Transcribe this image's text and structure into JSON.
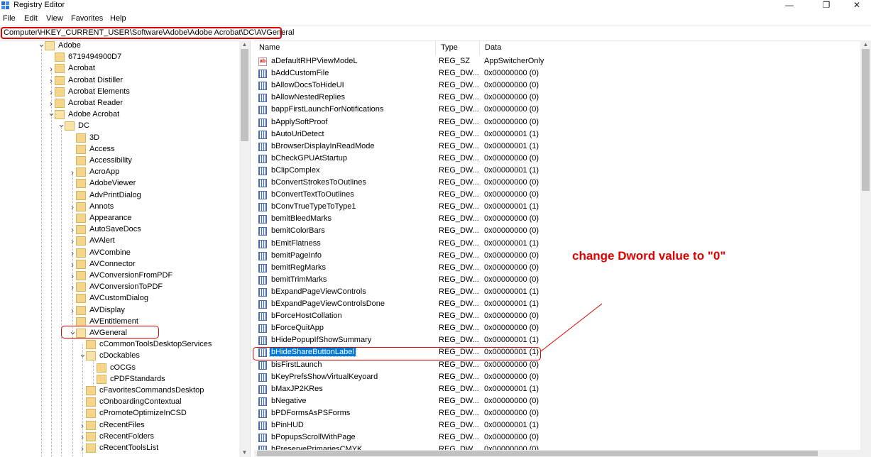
{
  "window": {
    "title": "Registry Editor",
    "minimize_glyph": "—",
    "maximize_glyph": "❐",
    "close_glyph": "✕"
  },
  "menu": [
    "File",
    "Edit",
    "View",
    "Favorites",
    "Help"
  ],
  "address": "Computer\\HKEY_CURRENT_USER\\Software\\Adobe\\Adobe Acrobat\\DC\\AVGeneral",
  "tree": [
    {
      "label": "Adobe",
      "level": 0,
      "state": "expanded"
    },
    {
      "label": "6719494900D7",
      "level": 1,
      "state": "leaf"
    },
    {
      "label": "Acrobat",
      "level": 1,
      "state": "collapsed"
    },
    {
      "label": "Acrobat Distiller",
      "level": 1,
      "state": "collapsed"
    },
    {
      "label": "Acrobat Elements",
      "level": 1,
      "state": "collapsed"
    },
    {
      "label": "Acrobat Reader",
      "level": 1,
      "state": "collapsed"
    },
    {
      "label": "Adobe Acrobat",
      "level": 1,
      "state": "expanded"
    },
    {
      "label": "DC",
      "level": 2,
      "state": "expanded"
    },
    {
      "label": "3D",
      "level": 3,
      "state": "leaf"
    },
    {
      "label": "Access",
      "level": 3,
      "state": "leaf"
    },
    {
      "label": "Accessibility",
      "level": 3,
      "state": "leaf"
    },
    {
      "label": "AcroApp",
      "level": 3,
      "state": "collapsed"
    },
    {
      "label": "AdobeViewer",
      "level": 3,
      "state": "leaf"
    },
    {
      "label": "AdvPrintDialog",
      "level": 3,
      "state": "leaf"
    },
    {
      "label": "Annots",
      "level": 3,
      "state": "collapsed"
    },
    {
      "label": "Appearance",
      "level": 3,
      "state": "leaf"
    },
    {
      "label": "AutoSaveDocs",
      "level": 3,
      "state": "collapsed"
    },
    {
      "label": "AVAlert",
      "level": 3,
      "state": "collapsed"
    },
    {
      "label": "AVCombine",
      "level": 3,
      "state": "collapsed"
    },
    {
      "label": "AVConnector",
      "level": 3,
      "state": "collapsed"
    },
    {
      "label": "AVConversionFromPDF",
      "level": 3,
      "state": "collapsed"
    },
    {
      "label": "AVConversionToPDF",
      "level": 3,
      "state": "collapsed"
    },
    {
      "label": "AVCustomDialog",
      "level": 3,
      "state": "leaf"
    },
    {
      "label": "AVDisplay",
      "level": 3,
      "state": "collapsed"
    },
    {
      "label": "AVEntitlement",
      "level": 3,
      "state": "leaf"
    },
    {
      "label": "AVGeneral",
      "level": 3,
      "state": "expanded",
      "selected": true
    },
    {
      "label": "cCommonToolsDesktopServices",
      "level": 4,
      "state": "leaf"
    },
    {
      "label": "cDockables",
      "level": 4,
      "state": "expanded"
    },
    {
      "label": "cOCGs",
      "level": 5,
      "state": "leaf"
    },
    {
      "label": "cPDFStandards",
      "level": 5,
      "state": "leaf"
    },
    {
      "label": "cFavoritesCommandsDesktop",
      "level": 4,
      "state": "leaf"
    },
    {
      "label": "cOnboardingContextual",
      "level": 4,
      "state": "leaf"
    },
    {
      "label": "cPromoteOptimizeInCSD",
      "level": 4,
      "state": "leaf"
    },
    {
      "label": "cRecentFiles",
      "level": 4,
      "state": "collapsed"
    },
    {
      "label": "cRecentFolders",
      "level": 4,
      "state": "collapsed"
    },
    {
      "label": "cRecentToolsList",
      "level": 4,
      "state": "collapsed"
    }
  ],
  "columns": {
    "name": "Name",
    "type": "Type",
    "data": "Data"
  },
  "values": [
    {
      "name": "aDefaultRHPViewModeL",
      "type": "REG_SZ",
      "data": "AppSwitcherOnly",
      "icon": "string-value-icon"
    },
    {
      "name": "bAddCustomFile",
      "type": "REG_DW...",
      "data": "0x00000000 (0)",
      "icon": "dword-value-icon"
    },
    {
      "name": "bAllowDocsToHideUI",
      "type": "REG_DW...",
      "data": "0x00000000 (0)",
      "icon": "dword-value-icon"
    },
    {
      "name": "bAllowNestedReplies",
      "type": "REG_DW...",
      "data": "0x00000000 (0)",
      "icon": "dword-value-icon"
    },
    {
      "name": "bappFirstLaunchForNotifications",
      "type": "REG_DW...",
      "data": "0x00000000 (0)",
      "icon": "dword-value-icon"
    },
    {
      "name": "bApplySoftProof",
      "type": "REG_DW...",
      "data": "0x00000000 (0)",
      "icon": "dword-value-icon"
    },
    {
      "name": "bAutoUriDetect",
      "type": "REG_DW...",
      "data": "0x00000001 (1)",
      "icon": "dword-value-icon"
    },
    {
      "name": "bBrowserDisplayInReadMode",
      "type": "REG_DW...",
      "data": "0x00000001 (1)",
      "icon": "dword-value-icon"
    },
    {
      "name": "bCheckGPUAtStartup",
      "type": "REG_DW...",
      "data": "0x00000000 (0)",
      "icon": "dword-value-icon"
    },
    {
      "name": "bClipComplex",
      "type": "REG_DW...",
      "data": "0x00000001 (1)",
      "icon": "dword-value-icon"
    },
    {
      "name": "bConvertStrokesToOutlines",
      "type": "REG_DW...",
      "data": "0x00000000 (0)",
      "icon": "dword-value-icon"
    },
    {
      "name": "bConvertTextToOutlines",
      "type": "REG_DW...",
      "data": "0x00000000 (0)",
      "icon": "dword-value-icon"
    },
    {
      "name": "bConvTrueTypeToType1",
      "type": "REG_DW...",
      "data": "0x00000001 (1)",
      "icon": "dword-value-icon"
    },
    {
      "name": "bemitBleedMarks",
      "type": "REG_DW...",
      "data": "0x00000000 (0)",
      "icon": "dword-value-icon"
    },
    {
      "name": "bemitColorBars",
      "type": "REG_DW...",
      "data": "0x00000000 (0)",
      "icon": "dword-value-icon"
    },
    {
      "name": "bEmitFlatness",
      "type": "REG_DW...",
      "data": "0x00000001 (1)",
      "icon": "dword-value-icon"
    },
    {
      "name": "bemitPageInfo",
      "type": "REG_DW...",
      "data": "0x00000000 (0)",
      "icon": "dword-value-icon"
    },
    {
      "name": "bemitRegMarks",
      "type": "REG_DW...",
      "data": "0x00000000 (0)",
      "icon": "dword-value-icon"
    },
    {
      "name": "bemitTrimMarks",
      "type": "REG_DW...",
      "data": "0x00000000 (0)",
      "icon": "dword-value-icon"
    },
    {
      "name": "bExpandPageViewControls",
      "type": "REG_DW...",
      "data": "0x00000001 (1)",
      "icon": "dword-value-icon"
    },
    {
      "name": "bExpandPageViewControlsDone",
      "type": "REG_DW...",
      "data": "0x00000001 (1)",
      "icon": "dword-value-icon"
    },
    {
      "name": "bForceHostCollation",
      "type": "REG_DW...",
      "data": "0x00000000 (0)",
      "icon": "dword-value-icon"
    },
    {
      "name": "bForceQuitApp",
      "type": "REG_DW...",
      "data": "0x00000000 (0)",
      "icon": "dword-value-icon"
    },
    {
      "name": "bHidePopupIfShowSummary",
      "type": "REG_DW...",
      "data": "0x00000001 (1)",
      "icon": "dword-value-icon"
    },
    {
      "name": "bHideShareButtonLabel",
      "type": "REG_DW...",
      "data": "0x00000001 (1)",
      "icon": "dword-value-icon",
      "selected": true
    },
    {
      "name": "bisFirstLaunch",
      "type": "REG_DW...",
      "data": "0x00000000 (0)",
      "icon": "dword-value-icon"
    },
    {
      "name": "bKeyPrefsShowVirtualKeyoard",
      "type": "REG_DW...",
      "data": "0x00000000 (0)",
      "icon": "dword-value-icon"
    },
    {
      "name": "bMaxJP2KRes",
      "type": "REG_DW...",
      "data": "0x00000001 (1)",
      "icon": "dword-value-icon"
    },
    {
      "name": "bNegative",
      "type": "REG_DW...",
      "data": "0x00000000 (0)",
      "icon": "dword-value-icon"
    },
    {
      "name": "bPDFormsAsPSForms",
      "type": "REG_DW...",
      "data": "0x00000000 (0)",
      "icon": "dword-value-icon"
    },
    {
      "name": "bPinHUD",
      "type": "REG_DW...",
      "data": "0x00000001 (1)",
      "icon": "dword-value-icon"
    },
    {
      "name": "bPopupsScrollWithPage",
      "type": "REG_DW...",
      "data": "0x00000000 (0)",
      "icon": "dword-value-icon"
    },
    {
      "name": "bPreservePrimariesCMYK",
      "type": "REG_DW...",
      "data": "0x00000000 (0)",
      "icon": "dword-value-icon"
    }
  ],
  "annotation": {
    "text": "change Dword value to \"0\"",
    "color": "#e00000"
  },
  "colors": {
    "selection": "#0078d7",
    "folder": "#f4d58b",
    "annotation": "#e00000"
  }
}
